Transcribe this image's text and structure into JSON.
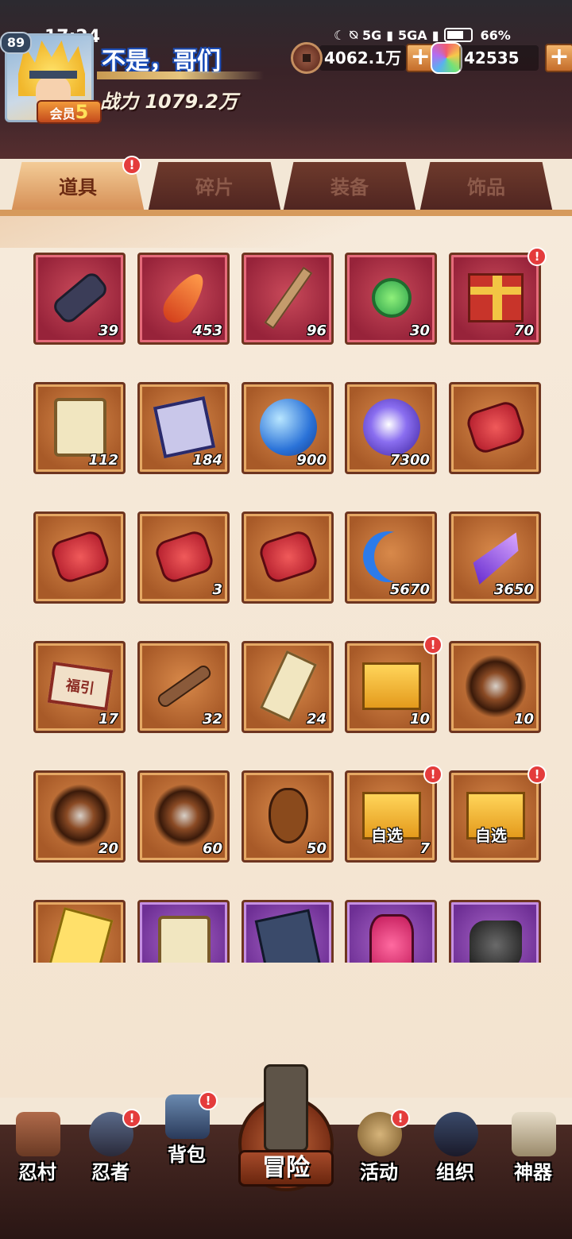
{
  "status_bar": {
    "time": "17:24",
    "network1": "5G",
    "network2": "5GA",
    "battery": "66%"
  },
  "player": {
    "level": "89",
    "name": "不是，哥们",
    "vip_label": "会员",
    "vip_level": "5",
    "power": "战力 1079.2万"
  },
  "currency": {
    "coins": "4062.1万",
    "gems": "42535",
    "add_symbol": "+"
  },
  "tabs": [
    {
      "label": "道具",
      "active": true
    },
    {
      "label": "碎片",
      "active": false
    },
    {
      "label": "装备",
      "active": false
    },
    {
      "label": "饰品",
      "active": false
    }
  ],
  "notify_mark": "!",
  "inventory": [
    {
      "icon": "scroll-icon",
      "count": "39",
      "frame": "red"
    },
    {
      "icon": "feather-icon",
      "count": "453",
      "frame": "red"
    },
    {
      "icon": "stick-icon",
      "count": "96",
      "frame": "red"
    },
    {
      "icon": "jade-pendant-icon",
      "count": "30",
      "frame": "red"
    },
    {
      "icon": "gift-box-icon",
      "count": "70",
      "frame": "red",
      "notify": true
    },
    {
      "icon": "parchment-scroll-icon",
      "count": "112",
      "frame": "orange"
    },
    {
      "icon": "ninja-card-icon",
      "count": "184",
      "frame": "orange"
    },
    {
      "icon": "blue-orb-icon",
      "count": "900",
      "frame": "orange"
    },
    {
      "icon": "purple-orb-icon",
      "count": "7300",
      "frame": "orange"
    },
    {
      "icon": "red-stone-fire-icon",
      "count": "",
      "frame": "orange"
    },
    {
      "icon": "red-stone-shield-icon",
      "count": "",
      "frame": "orange"
    },
    {
      "icon": "red-stone-target-icon",
      "count": "3",
      "frame": "orange"
    },
    {
      "icon": "red-stone-eye-icon",
      "count": "",
      "frame": "orange"
    },
    {
      "icon": "blue-moon-icon",
      "count": "5670",
      "frame": "orange"
    },
    {
      "icon": "purple-crystal-icon",
      "count": "3650",
      "frame": "orange"
    },
    {
      "icon": "fortune-banner-icon",
      "count": "17",
      "frame": "orange",
      "art_text": "福引"
    },
    {
      "icon": "key-icon",
      "count": "32",
      "frame": "orange"
    },
    {
      "icon": "talisman-icon",
      "count": "24",
      "frame": "orange"
    },
    {
      "icon": "golden-box-icon",
      "count": "10",
      "frame": "orange",
      "notify": true
    },
    {
      "icon": "silver-kunai-swirl-icon",
      "count": "10",
      "frame": "orange"
    },
    {
      "icon": "fan-swirl-icon",
      "count": "20",
      "frame": "orange"
    },
    {
      "icon": "rope-swirl-icon",
      "count": "60",
      "frame": "orange"
    },
    {
      "icon": "gourd-swirl-icon",
      "count": "50",
      "frame": "orange"
    },
    {
      "icon": "choice-box-gold-icon",
      "count": "7",
      "frame": "orange",
      "notify": true,
      "choose": "自选"
    },
    {
      "icon": "choice-box-red-icon",
      "count": "",
      "frame": "orange",
      "notify": true,
      "choose": "自选"
    },
    {
      "icon": "point-card-icon",
      "count": "",
      "frame": "orange"
    },
    {
      "icon": "purple-scroll-icon",
      "count": "",
      "frame": "purple"
    },
    {
      "icon": "skill-book-icon",
      "count": "",
      "frame": "purple"
    },
    {
      "icon": "pink-jar-icon",
      "count": "",
      "frame": "purple"
    },
    {
      "icon": "black-rock-icon",
      "count": "",
      "frame": "purple"
    }
  ],
  "bottom_nav": [
    {
      "label": "忍村",
      "icon": "village-gate-icon",
      "notify": false
    },
    {
      "label": "忍者",
      "icon": "ninja-head-icon",
      "notify": true
    },
    {
      "label": "背包",
      "icon": "backpack-icon",
      "notify": true
    },
    {
      "label": "冒险",
      "icon": "adventure-scroll-icon",
      "notify": false,
      "center": true
    },
    {
      "label": "活动",
      "icon": "crossed-kunai-icon",
      "notify": true
    },
    {
      "label": "组织",
      "icon": "squad-icon",
      "notify": false
    },
    {
      "label": "神器",
      "icon": "artifact-scroll-icon",
      "notify": false
    }
  ],
  "colors": {
    "tab_active": "#f3cc97",
    "notify_red": "#e43c3c",
    "frame_red": "#97233a",
    "frame_orange": "#a85a28",
    "frame_purple": "#6e2f95"
  }
}
